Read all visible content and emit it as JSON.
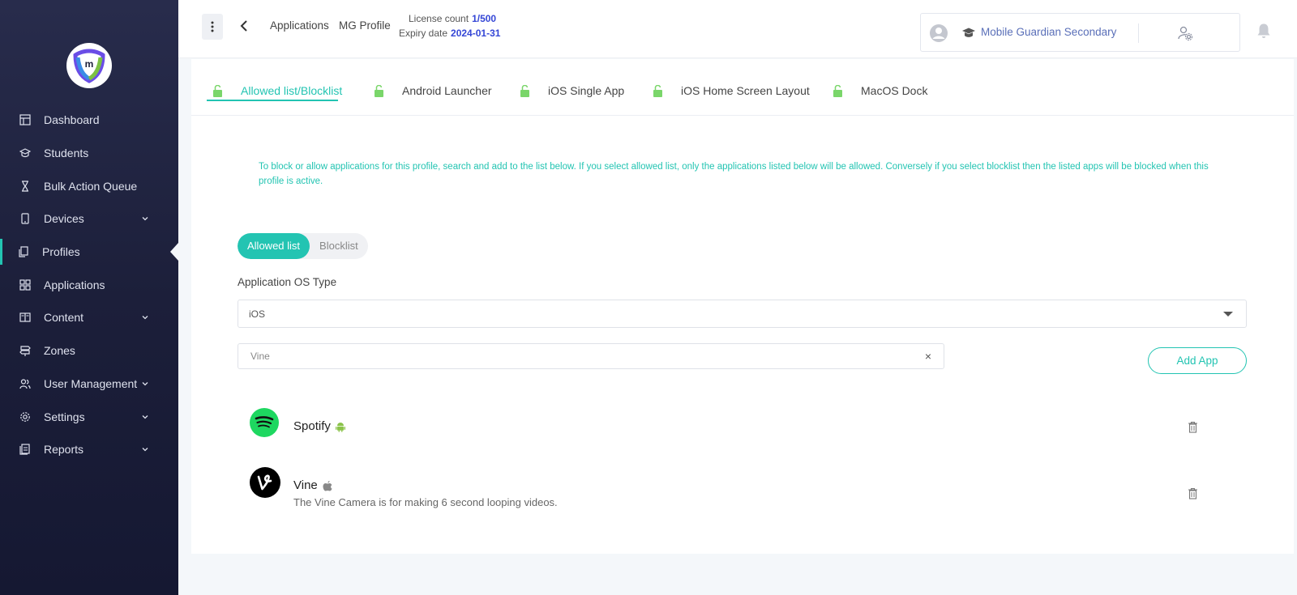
{
  "sidebar": {
    "items": [
      {
        "label": "Dashboard",
        "icon": "dashboard-icon",
        "chevron": false
      },
      {
        "label": "Students",
        "icon": "graduation-cap-icon",
        "chevron": false
      },
      {
        "label": "Bulk Action Queue",
        "icon": "hourglass-icon",
        "chevron": false
      },
      {
        "label": "Devices",
        "icon": "phone-icon",
        "chevron": true
      },
      {
        "label": "Profiles",
        "icon": "documents-icon",
        "chevron": false,
        "active": true
      },
      {
        "label": "Applications",
        "icon": "grid-icon",
        "chevron": false
      },
      {
        "label": "Content",
        "icon": "book-icon",
        "chevron": true
      },
      {
        "label": "Zones",
        "icon": "signpost-icon",
        "chevron": false
      },
      {
        "label": "User Management",
        "icon": "users-icon",
        "chevron": true
      },
      {
        "label": "Settings",
        "icon": "gear-icon",
        "chevron": true
      },
      {
        "label": "Reports",
        "icon": "report-icon",
        "chevron": true
      }
    ]
  },
  "header": {
    "breadcrumb_1": "Applications",
    "breadcrumb_2": "MG Profile",
    "license_label": "License count",
    "license_value": "1/500",
    "expiry_label": "Expiry date",
    "expiry_value": "2024-01-31",
    "school_name": "Mobile Guardian Secondary"
  },
  "tabs": [
    {
      "label": "Allowed list/Blocklist",
      "active": true
    },
    {
      "label": "Android Launcher"
    },
    {
      "label": "iOS Single App"
    },
    {
      "label": "iOS Home Screen Layout"
    },
    {
      "label": "MacOS Dock"
    }
  ],
  "main": {
    "info": "To block or allow applications for this profile, search and add to the list below. If you select allowed list, only the applications listed below will be allowed. Conversely if you select blocklist then the listed apps will be blocked when this profile is active.",
    "toggle_allowed": "Allowed list",
    "toggle_block": "Blocklist",
    "os_label": "Application OS Type",
    "os_value": "iOS",
    "search_value": "Vine",
    "clear_symbol": "×",
    "add_button": "Add App"
  },
  "apps": [
    {
      "name": "Spotify",
      "platform": "android-icon",
      "description": ""
    },
    {
      "name": "Vine",
      "platform": "apple-icon",
      "description": "The Vine Camera is for making 6 second looping videos."
    }
  ],
  "colors": {
    "accent": "#23c4b2",
    "link_blue": "#3446d6",
    "sidebar_bg": "#1c1f3a"
  }
}
